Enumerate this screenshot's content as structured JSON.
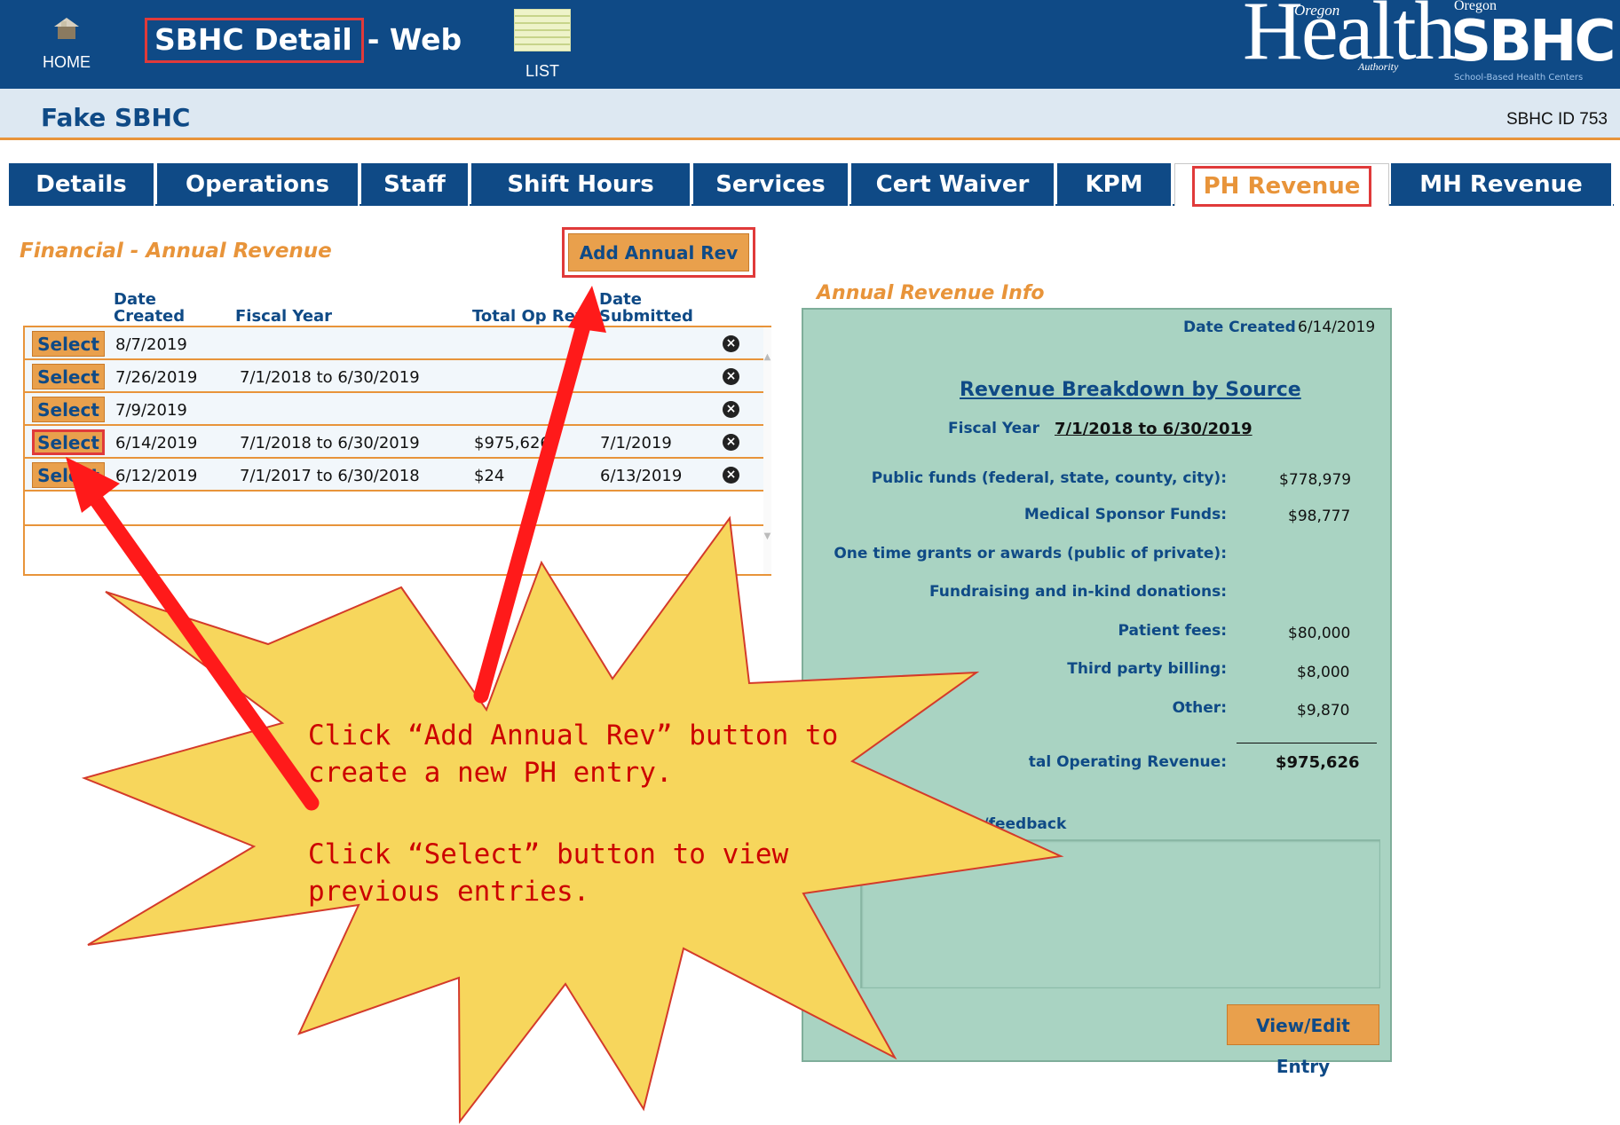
{
  "header": {
    "home_label": "HOME",
    "title": "SBHC Detail",
    "title_suffix": "- Web",
    "list_label": "LIST",
    "oha_logo_word": "Health",
    "oha_logo_state": "Oregon",
    "oha_logo_authority": "Authority",
    "sbhc_logo_state": "Oregon",
    "sbhc_logo_word": "SBHC",
    "sbhc_logo_tagline": "School-Based Health Centers"
  },
  "site": {
    "name": "Fake SBHC",
    "id_label": "SBHC ID 753"
  },
  "tabs": [
    {
      "label": "Details"
    },
    {
      "label": "Operations"
    },
    {
      "label": "Staff"
    },
    {
      "label": "Shift Hours"
    },
    {
      "label": "Services"
    },
    {
      "label": "Cert Waiver"
    },
    {
      "label": "KPM"
    },
    {
      "label": "PH Revenue",
      "active": true
    },
    {
      "label": "MH Revenue"
    }
  ],
  "list": {
    "section_title": "Financial - Annual Revenue",
    "add_button": "Add Annual Rev",
    "columns": {
      "date_created_1": "Date",
      "date_created_2": "Created",
      "fiscal_year": "Fiscal Year",
      "total_op_rev": "Total Op Rev",
      "date_submitted_1": "Date",
      "date_submitted_2": "Submitted"
    },
    "select_label": "Select",
    "rows": [
      {
        "date_created": "8/7/2019",
        "fiscal_year": "",
        "total": "",
        "submitted": ""
      },
      {
        "date_created": "7/26/2019",
        "fiscal_year": "7/1/2018 to 6/30/2019",
        "total": "",
        "submitted": ""
      },
      {
        "date_created": "7/9/2019",
        "fiscal_year": "",
        "total": "",
        "submitted": ""
      },
      {
        "date_created": "6/14/2019",
        "fiscal_year": "7/1/2018 to 6/30/2019",
        "total": "$975,626",
        "submitted": "7/1/2019"
      },
      {
        "date_created": "6/12/2019",
        "fiscal_year": "7/1/2017 to 6/30/2018",
        "total": "$24",
        "submitted": "6/13/2019"
      }
    ]
  },
  "info": {
    "title": "Annual Revenue Info",
    "date_created_label": "Date Created",
    "date_created_value": "6/14/2019",
    "breakdown_link": "Revenue Breakdown by Source",
    "fiscal_year_label": "Fiscal Year",
    "fiscal_year_value": "7/1/2018 to 6/30/2019",
    "public_funds_label": "Public funds (federal, state, county, city):",
    "public_funds_value": "$778,979",
    "medical_sponsor_label": "Medical Sponsor Funds:",
    "medical_sponsor_value": "$98,777",
    "one_time_grants_label": "One time grants or awards (public of private):",
    "fundraising_label": "Fundraising and in-kind donations:",
    "patient_fees_label": "Patient fees:",
    "patient_fees_value": "$80,000",
    "third_party_label": "Third party billing:",
    "third_party_value": "$8,000",
    "other_label": "Other:",
    "other_value": "$9,870",
    "total_label": "tal Operating Revenue:",
    "total_value": "$975,626",
    "feedback_label": "explanations/feedback",
    "view_edit_button": "View/Edit Entry"
  },
  "callout": {
    "line1": "Click “Add Annual Rev” button to",
    "line2": "create a new PH entry.",
    "line3": "Click “Select” button to view",
    "line4": "previous entries."
  },
  "colors": {
    "header_blue": "#0f4a86",
    "accent_orange": "#e8943a",
    "button_orange": "#e9a04c",
    "panel_green": "#a9d3c2",
    "highlight_red": "#e03a3a",
    "callout_yellow": "#f7d65c"
  }
}
